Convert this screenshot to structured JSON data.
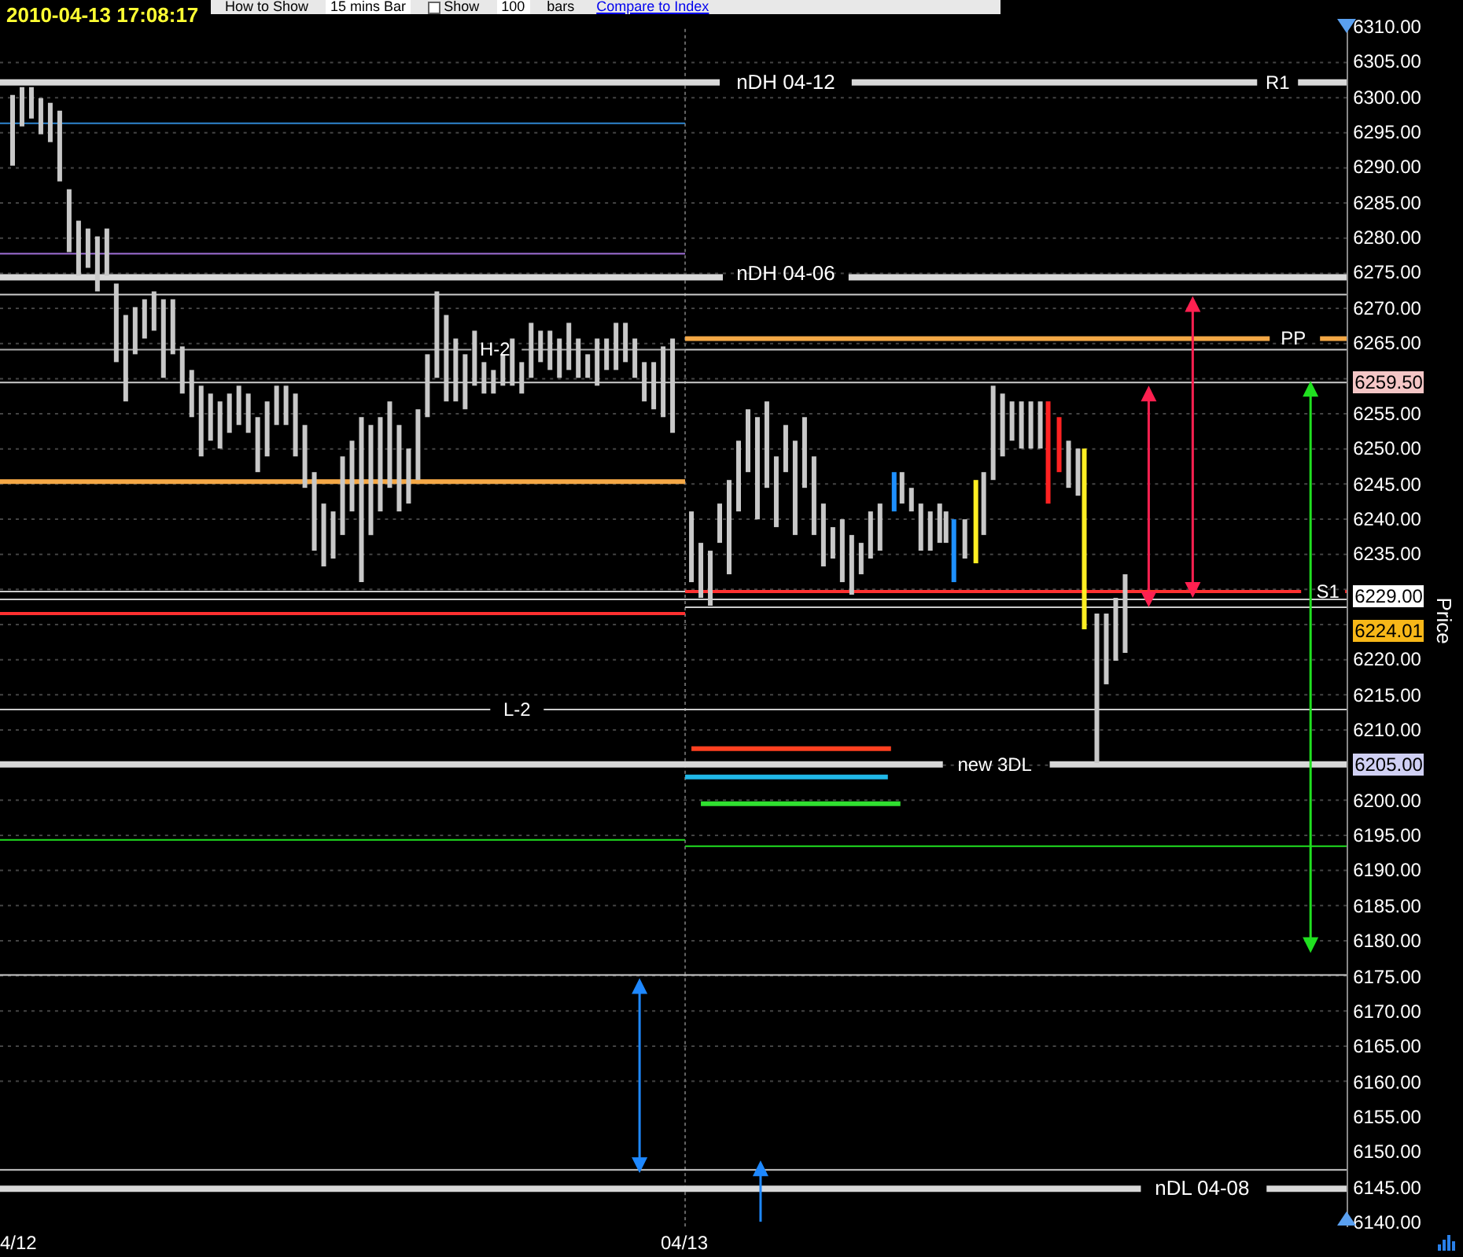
{
  "header": {
    "timestamp": "2010-04-13 17:08:17",
    "toolbar": [
      {
        "kind": "label",
        "text": "How to Show"
      },
      {
        "kind": "select",
        "text": "15 mins Bar"
      },
      {
        "kind": "checkbox",
        "text": "Show",
        "checked": false
      },
      {
        "kind": "field",
        "text": "100"
      },
      {
        "kind": "label",
        "text": "bars"
      },
      {
        "kind": "link",
        "text": "Compare to Index"
      }
    ]
  },
  "level_labels": [
    "nDH 04-12",
    "R1",
    "nDH 04-06",
    "PP",
    "H-2",
    "S1",
    "L-2",
    "new 3DL",
    "nDL 04-08"
  ],
  "price_axis": {
    "title": "Price",
    "ticks": [
      "6310.00",
      "6305.00",
      "6300.00",
      "6295.00",
      "6290.00",
      "6285.00",
      "6280.00",
      "6275.00",
      "6270.00",
      "6265.00",
      "6255.00",
      "6250.00",
      "6245.00",
      "6240.00",
      "6235.00",
      "6220.00",
      "6215.00",
      "6210.00",
      "6200.00",
      "6195.00",
      "6190.00",
      "6185.00",
      "6180.00",
      "6175.00",
      "6170.00",
      "6165.00",
      "6160.00",
      "6155.00",
      "6150.00",
      "6145.00",
      "6140.00"
    ],
    "markers": [
      {
        "text": "6259.50",
        "color": "#f4c6c6"
      },
      {
        "text": "6229.00",
        "color": "#ffffff"
      },
      {
        "text": "6224.01",
        "color": "#f7b718"
      },
      {
        "text": "6205.00",
        "color": "#d0d0f4"
      }
    ]
  },
  "dates": [
    "4/12",
    "04/13"
  ]
}
